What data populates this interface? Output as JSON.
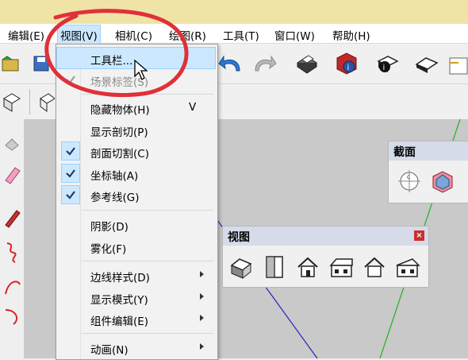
{
  "menubar": {
    "items": [
      {
        "label": "编辑(E)"
      },
      {
        "label": "视图(V)"
      },
      {
        "label": "相机(C)"
      },
      {
        "label": "绘图(R)"
      },
      {
        "label": "工具(T)"
      },
      {
        "label": "窗口(W)"
      },
      {
        "label": "帮助(H)"
      }
    ]
  },
  "view_menu": {
    "items": [
      {
        "label": "工具栏...",
        "highlighted": true
      },
      {
        "label": "场景标签(S)",
        "disabled": true,
        "checked": true
      },
      {
        "label": "隐藏物体(H)",
        "shortcut": "V"
      },
      {
        "label": "显示剖切(P)"
      },
      {
        "label": "剖面切割(C)",
        "checked": true
      },
      {
        "label": "坐标轴(A)",
        "checked": true
      },
      {
        "label": "参考线(G)",
        "checked": true
      },
      {
        "label": "阴影(D)"
      },
      {
        "label": "雾化(F)"
      },
      {
        "label": "边线样式(D)",
        "submenu": true
      },
      {
        "label": "显示模式(Y)",
        "submenu": true
      },
      {
        "label": "组件编辑(E)",
        "submenu": true
      },
      {
        "label": "动画(N)",
        "submenu": true
      }
    ]
  },
  "section_panel": {
    "title": "截面"
  },
  "view_panel": {
    "title": "视图",
    "close": "×",
    "icons": [
      "iso-view-icon",
      "top-view-icon",
      "front-view-icon",
      "right-view-icon",
      "back-view-icon",
      "left-view-icon"
    ]
  },
  "colors": {
    "annotation_circle": "#e0303a",
    "highlight": "#cce8ff",
    "title_bar": "#efe3a6"
  }
}
